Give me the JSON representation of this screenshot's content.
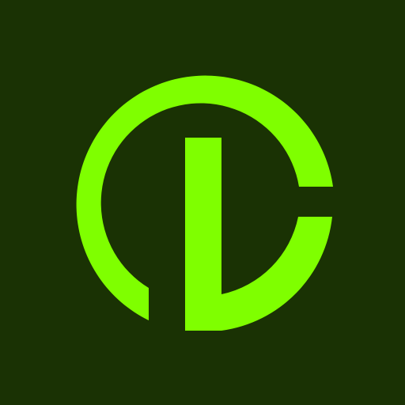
{
  "app_icon": {
    "icon": "cl-monogram-logo-icon",
    "background_color": "#1a3204",
    "accent_color": "#7fff00"
  }
}
